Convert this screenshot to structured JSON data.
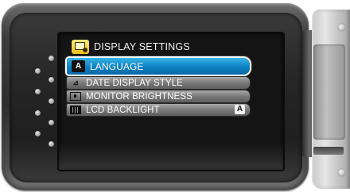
{
  "screen": {
    "title": "DISPLAY SETTINGS",
    "title_icon": "display-settings-icon",
    "items": [
      {
        "label": "LANGUAGE",
        "icon": "language-icon",
        "icon_glyph": "A",
        "selected": true
      },
      {
        "label": "DATE DISPLAY STYLE",
        "icon": "date-style-icon",
        "icon_glyph": "⊿"
      },
      {
        "label": "MONITOR BRIGHTNESS",
        "icon": "monitor-brightness-icon",
        "icon_glyph": ""
      },
      {
        "label": "LCD BACKLIGHT",
        "icon": "lcd-backlight-icon",
        "icon_glyph": "",
        "badge": "A"
      }
    ]
  },
  "colors": {
    "selection": "#0f84c6",
    "title_icon": "#f0c21a",
    "body": "#2f2f2f",
    "side_panel": "#d6d6d6"
  }
}
